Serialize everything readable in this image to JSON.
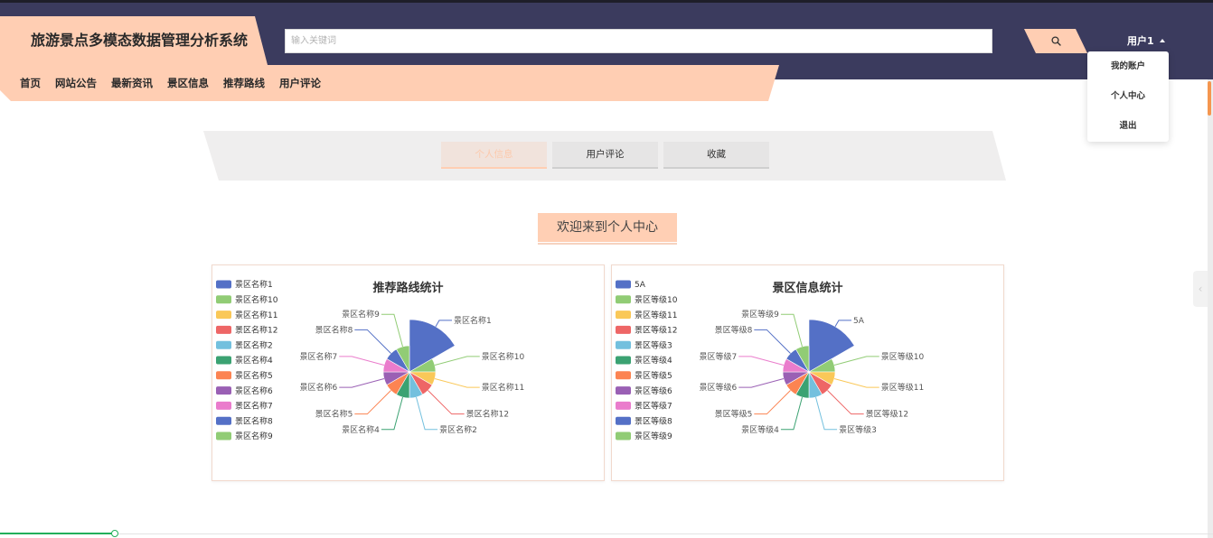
{
  "header": {
    "site_title": "旅游景点多模态数据管理分析系统",
    "nav": [
      {
        "label": "首页"
      },
      {
        "label": "网站公告"
      },
      {
        "label": "最新资讯"
      },
      {
        "label": "景区信息"
      },
      {
        "label": "推荐路线"
      },
      {
        "label": "用户评论"
      }
    ],
    "search": {
      "placeholder": "输入关键词",
      "button_icon": "search-icon"
    },
    "user": {
      "name": "用户1",
      "caret_icon": "caret-up-icon"
    },
    "user_menu": [
      {
        "label": "我的账户"
      },
      {
        "label": "个人中心"
      },
      {
        "label": "退出"
      }
    ]
  },
  "tabs": [
    {
      "label": "个人信息",
      "active": true
    },
    {
      "label": "用户评论",
      "active": false
    },
    {
      "label": "收藏",
      "active": false
    }
  ],
  "welcome_title": "欢迎来到个人中心",
  "chart_data": [
    {
      "type": "pie",
      "rose_type": "radius",
      "title": "推荐路线统计",
      "categories": [
        "景区名称1",
        "景区名称10",
        "景区名称11",
        "景区名称12",
        "景区名称2",
        "景区名称4",
        "景区名称5",
        "景区名称6",
        "景区名称7",
        "景区名称8",
        "景区名称9"
      ],
      "values": [
        2,
        1,
        1,
        1,
        1,
        1,
        1,
        1,
        1,
        1,
        1
      ],
      "legend": "left",
      "colors": [
        "#5470c6",
        "#91cc75",
        "#fac858",
        "#ee6666",
        "#73c0de",
        "#3ba272",
        "#fc8452",
        "#9a60b4",
        "#ea7ccc"
      ]
    },
    {
      "type": "pie",
      "rose_type": "radius",
      "title": "景区信息统计",
      "categories": [
        "5A",
        "景区等级10",
        "景区等级11",
        "景区等级12",
        "景区等级3",
        "景区等级4",
        "景区等级5",
        "景区等级6",
        "景区等级7",
        "景区等级8",
        "景区等级9"
      ],
      "values": [
        2,
        1,
        1,
        1,
        1,
        1,
        1,
        1,
        1,
        1,
        1
      ],
      "legend": "left",
      "colors": [
        "#5470c6",
        "#91cc75",
        "#fac858",
        "#ee6666",
        "#73c0de",
        "#3ba272",
        "#fc8452",
        "#9a60b4",
        "#ea7ccc"
      ]
    }
  ],
  "side_button": {
    "icon": "chevron-left-icon"
  },
  "playback_progress": {
    "fraction": 0.095
  },
  "colors": {
    "header_bg": "#3b3b5e",
    "accent": "#ffceb3",
    "progress": "#22b05b",
    "scroll_thumb": "#f5964f"
  }
}
